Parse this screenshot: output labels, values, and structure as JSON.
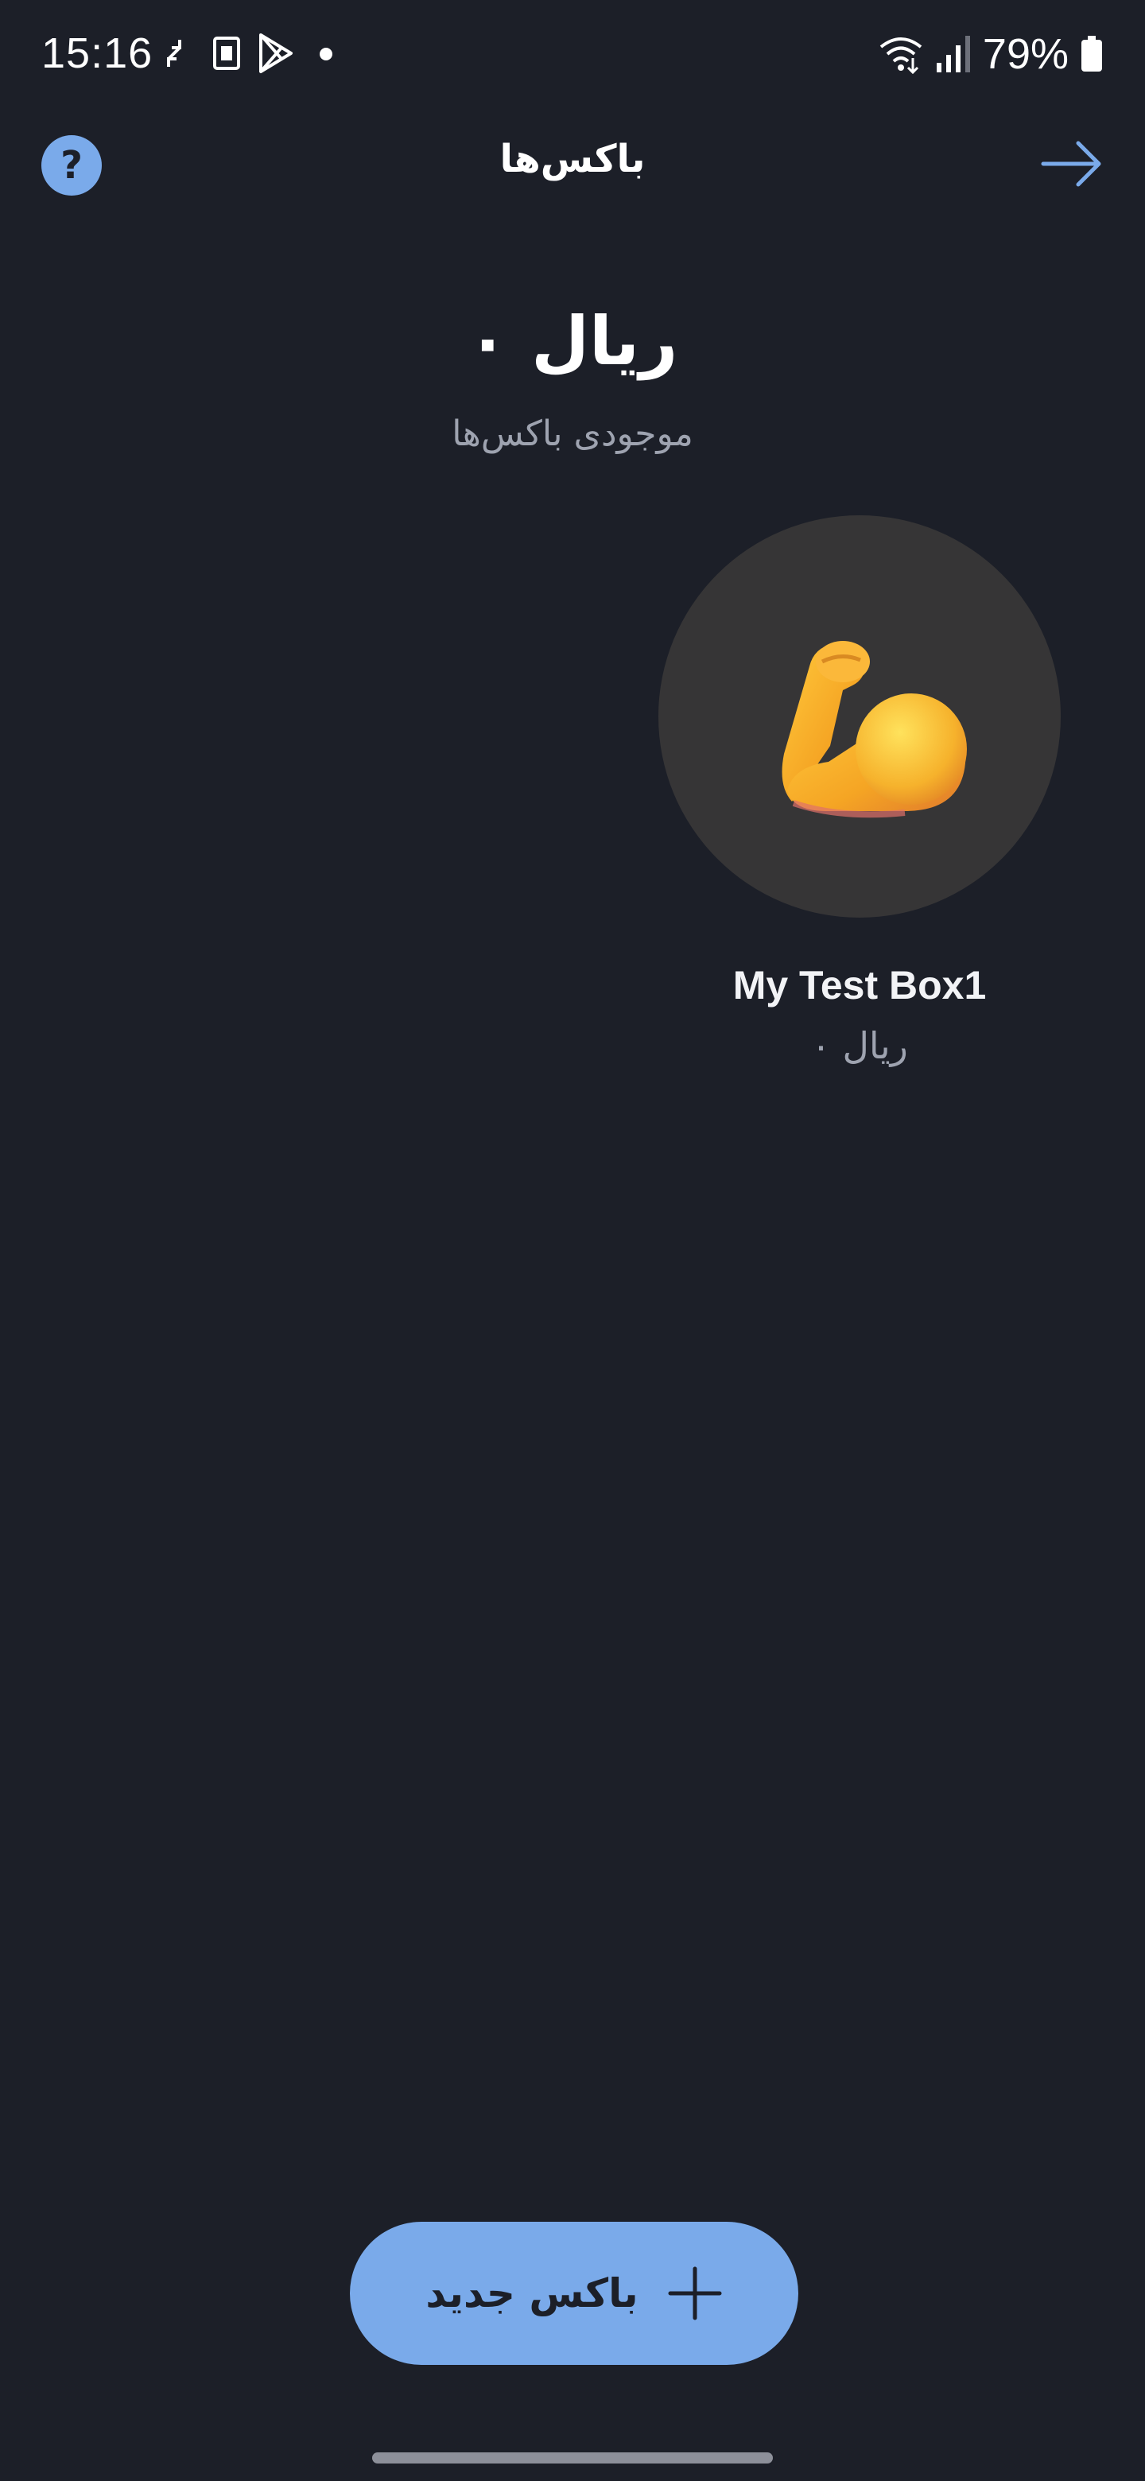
{
  "status_bar": {
    "time": "15:16",
    "battery_percent": "79%"
  },
  "header": {
    "title": "باکس‌ها",
    "help_symbol": "?"
  },
  "summary": {
    "total_balance": "۰ ریال",
    "label": "موجودی باکس‌ها"
  },
  "boxes": [
    {
      "name": "My Test Box1",
      "balance": "۰ ریال",
      "icon": "flexed-biceps-icon"
    }
  ],
  "actions": {
    "new_box_label": "باکس جدید"
  },
  "colors": {
    "background": "#1c1f28",
    "accent": "#7aaaea",
    "avatar_bg": "#363536",
    "muted_text": "#9ea3b0"
  }
}
